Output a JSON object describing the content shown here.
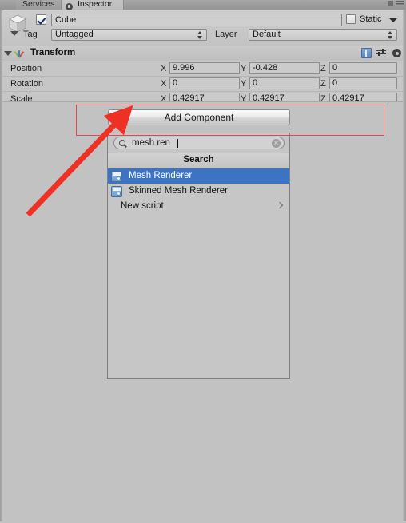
{
  "window": {
    "tabs": [
      {
        "label": "Services",
        "active": false
      },
      {
        "label": "Inspector",
        "active": true
      }
    ],
    "lock_icon": "lock-icon",
    "menu_icon": "hamburger-menu-icon"
  },
  "object_header": {
    "object_icon": "cube-icon",
    "active_checkbox_checked": true,
    "name": "Cube",
    "static_label": "Static",
    "static_checked": false,
    "static_dropdown_icon": "chevron-down-icon",
    "tag_label": "Tag",
    "tag_value": "Untagged",
    "layer_label": "Layer",
    "layer_value": "Default"
  },
  "transform": {
    "title": "Transform",
    "foldout_icon": "foldout-open-icon",
    "component_icon": "transform-axes-icon",
    "tools": [
      {
        "name": "help-book-icon"
      },
      {
        "name": "preset-icon"
      },
      {
        "name": "gear-icon"
      }
    ],
    "axes": {
      "x": "X",
      "y": "Y",
      "z": "Z"
    },
    "rows": [
      {
        "label": "Position",
        "x": "9.996",
        "y": "-0.428",
        "z": "0"
      },
      {
        "label": "Rotation",
        "x": "0",
        "y": "0",
        "z": "0"
      },
      {
        "label": "Scale",
        "x": "0.42917",
        "y": "0.42917",
        "z": "0.42917"
      }
    ]
  },
  "add_component": {
    "label": "Add Component"
  },
  "search_popup": {
    "search_icon": "search-icon",
    "query": "mesh ren",
    "clear_icon": "clear-circle-icon",
    "header": "Search",
    "results": [
      {
        "label": "Mesh Renderer",
        "icon": "mesh-renderer-icon",
        "selected": true,
        "has_submenu": false
      },
      {
        "label": "Skinned Mesh Renderer",
        "icon": "skinned-mesh-renderer-icon",
        "selected": false,
        "has_submenu": false
      },
      {
        "label": "New script",
        "icon": null,
        "selected": false,
        "has_submenu": true
      }
    ]
  },
  "annotations": {
    "highlight_color": "#e04a4a",
    "arrow_color": "#ee3124",
    "rect_target": "add-component-button",
    "arrow_points_to": "add-component-button"
  }
}
